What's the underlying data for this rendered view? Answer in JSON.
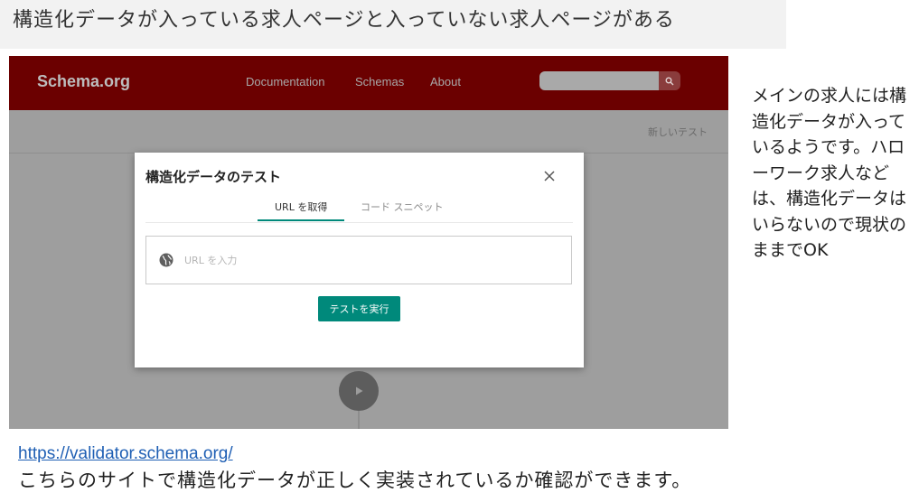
{
  "slide": {
    "title": "構造化データが入っている求人ページと入っていない求人ページがある",
    "side_note": "メインの求人には構造化データが入っているようです。ハローワーク求人などは、構造化データはいらないので現状のままでOK",
    "link": "https://validator.schema.org/",
    "caption": "こちらのサイトで構造化データが正しく実装されているか確認ができます。"
  },
  "app": {
    "brand": "Schema.org",
    "nav": [
      "Documentation",
      "Schemas",
      "About"
    ],
    "search_placeholder": "",
    "new_test_label": "新しいテスト",
    "accent_color": "#00897b",
    "header_color": "#6b0000"
  },
  "modal": {
    "title": "構造化データのテスト",
    "tabs": [
      {
        "label": "URL を取得",
        "active": true
      },
      {
        "label": "コード スニペット",
        "active": false
      }
    ],
    "url_placeholder": "URL を入力",
    "run_label": "テストを実行"
  },
  "icons": {
    "search": "search-icon",
    "close": "close-icon",
    "globe": "globe-icon",
    "play": "play-icon"
  }
}
